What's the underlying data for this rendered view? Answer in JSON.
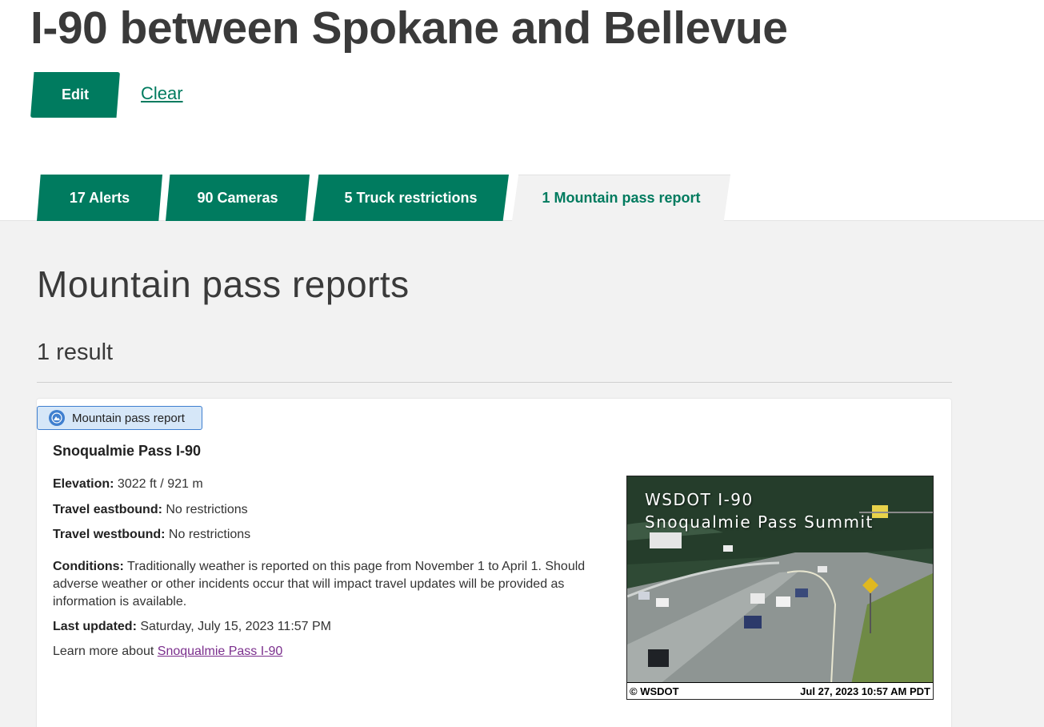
{
  "page": {
    "title": "I-90 between Spokane and Bellevue",
    "edit_label": "Edit",
    "clear_label": "Clear"
  },
  "tabs": [
    {
      "label": "17 Alerts",
      "active": false
    },
    {
      "label": "90 Cameras",
      "active": false
    },
    {
      "label": "5 Truck restrictions",
      "active": false
    },
    {
      "label": "1 Mountain pass report",
      "active": true
    }
  ],
  "section": {
    "title": "Mountain pass reports",
    "result_count": "1 result"
  },
  "card": {
    "badge_label": "Mountain pass report",
    "badge_icon": "mountain-icon",
    "title": "Snoqualmie Pass I-90",
    "elevation_label": "Elevation:",
    "elevation_value": "3022 ft / 921 m",
    "eastbound_label": "Travel eastbound:",
    "eastbound_value": "No restrictions",
    "westbound_label": "Travel westbound:",
    "westbound_value": "No restrictions",
    "conditions_label": "Conditions:",
    "conditions_value": "Traditionally weather is reported on this page from November 1 to April 1. Should adverse weather or other incidents occur that will impact travel updates will be provided as information is available.",
    "updated_label": "Last updated:",
    "updated_value": "Saturday, July 15, 2023 11:57 PM",
    "learn_more_text": "Learn more about",
    "learn_more_link": "Snoqualmie Pass I-90",
    "camera": {
      "overlay_line1": "WSDOT  I-90",
      "overlay_line2": "Snoqualmie Pass Summit",
      "caption_left": "© WSDOT",
      "caption_right": "Jul 27, 2023 10:57 AM PDT"
    }
  },
  "colors": {
    "brand_green": "#007b5f",
    "badge_blue": "#3f7fcf",
    "link_purple": "#7b2f8d"
  }
}
